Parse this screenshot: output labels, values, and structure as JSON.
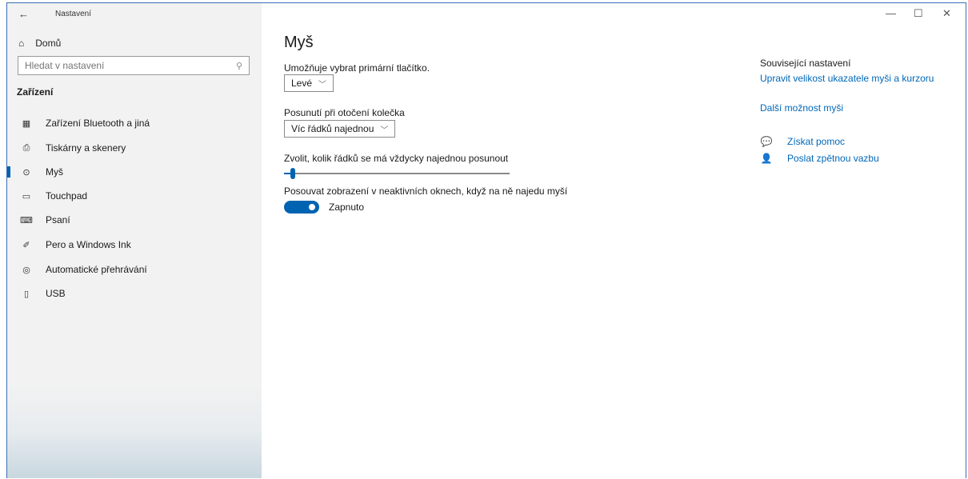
{
  "window": {
    "title": "Nastavení",
    "back_glyph": "←",
    "minimize_glyph": "—",
    "maximize_glyph": "☐",
    "close_glyph": "✕"
  },
  "sidebar": {
    "home_label": "Domů",
    "home_icon": "⌂",
    "search_placeholder": "Hledat v nastavení",
    "search_icon": "⚲",
    "section_title": "Zařízení",
    "items": [
      {
        "label": "Zařízení Bluetooth a jiná",
        "icon": "▦"
      },
      {
        "label": "Tiskárny a skenery",
        "icon": "⎙"
      },
      {
        "label": "Myš",
        "icon": "⊙"
      },
      {
        "label": "Touchpad",
        "icon": "▭"
      },
      {
        "label": "Psaní",
        "icon": "⌨"
      },
      {
        "label": "Pero a Windows Ink",
        "icon": "✐"
      },
      {
        "label": "Automatické přehrávání",
        "icon": "◎"
      },
      {
        "label": "USB",
        "icon": "▯"
      }
    ],
    "active_index": 2
  },
  "main": {
    "title": "Myš",
    "primary_button_label": "Umožňuje vybrat primární tlačítko.",
    "primary_button_value": "Levé",
    "scroll_label": "Posunutí při otočení kolečka",
    "scroll_value": "Víc řádků najednou",
    "lines_label": "Zvolit, kolik řádků se má vždycky najednou posunout",
    "lines_level_fraction": 0.03,
    "inactive_label": "Posouvat zobrazení v neaktivních oknech, když na ně najedu myší",
    "inactive_state": "Zapnuto",
    "chevron_glyph": "﹀"
  },
  "related": {
    "heading": "Související nastavení",
    "link1": "Upravit velikost ukazatele myši a kurzoru",
    "link2": "Další možnost myši",
    "help1": "Získat pomoc",
    "help1_icon": "💬",
    "help2": "Poslat zpětnou vazbu",
    "help2_icon": "👤"
  },
  "colors": {
    "accent": "#0063b1",
    "link": "#0067b8",
    "sidebar_bg": "#f2f2f2"
  }
}
